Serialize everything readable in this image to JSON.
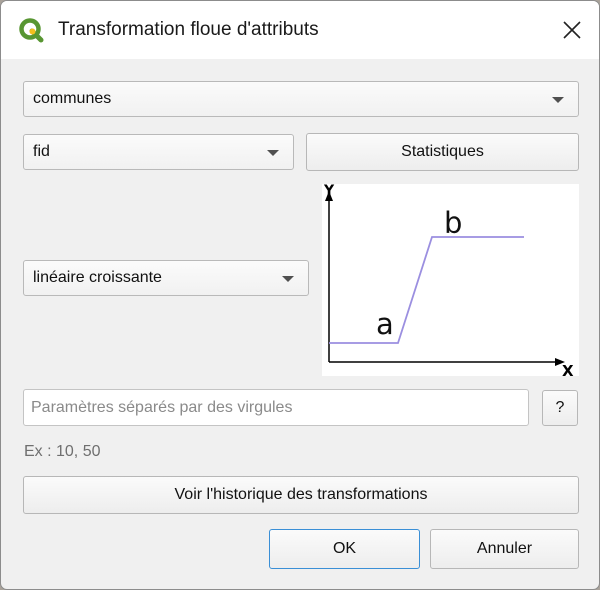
{
  "window": {
    "title": "Transformation floue d'attributs",
    "app_icon": "qgis-logo-icon",
    "close_icon": "close-icon"
  },
  "layer_combo": {
    "value": "communes"
  },
  "field_combo": {
    "value": "fid"
  },
  "statistics_button": {
    "label": "Statistiques"
  },
  "function_combo": {
    "value": "linéaire croissante"
  },
  "graph": {
    "y_label": "Y",
    "x_label": "X",
    "point_a_label": "a",
    "point_b_label": "b",
    "curve_color": "#9b8fe0"
  },
  "parameters_input": {
    "value": "",
    "placeholder": "Paramètres séparés par des virgules"
  },
  "help_button": {
    "label": "?"
  },
  "example_text": "Ex : 10, 50",
  "history_button": {
    "label": "Voir l'historique des transformations"
  },
  "ok_button": {
    "label": "OK"
  },
  "cancel_button": {
    "label": "Annuler"
  },
  "colors": {
    "dialog_background": "#f0f0f0",
    "default_button_border": "#3a8fd6",
    "qgis_green": "#589632",
    "qgis_yellow": "#ee7913"
  }
}
